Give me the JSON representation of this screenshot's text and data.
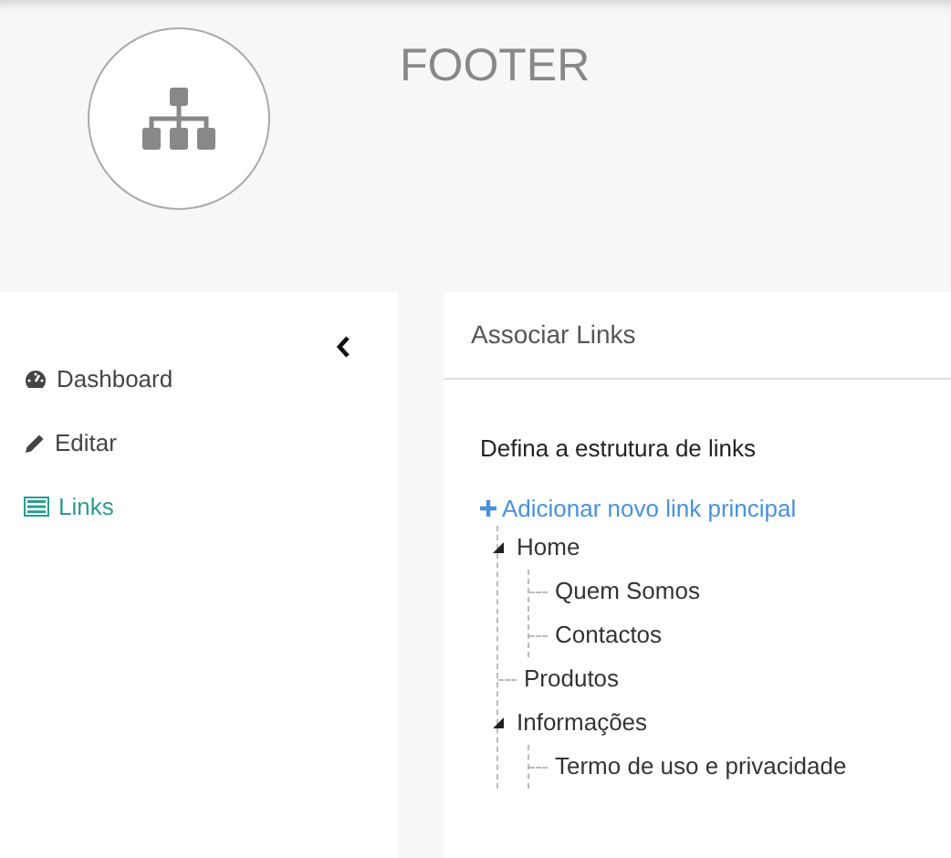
{
  "header": {
    "title": "FOOTER"
  },
  "sidebar": {
    "items": [
      {
        "label": "Dashboard",
        "selected": false
      },
      {
        "label": "Editar",
        "selected": false
      },
      {
        "label": "Links",
        "selected": true
      }
    ]
  },
  "panel": {
    "title": "Associar Links",
    "description": "Defina a estrutura de links",
    "add_link": "Adicionar novo link principal",
    "tree": [
      {
        "label": "Home",
        "expanded": true,
        "children": [
          {
            "label": "Quem Somos"
          },
          {
            "label": "Contactos"
          }
        ]
      },
      {
        "label": "Produtos"
      },
      {
        "label": "Informações",
        "expanded": true,
        "children": [
          {
            "label": "Termo de uso e privacidade"
          }
        ]
      }
    ]
  }
}
